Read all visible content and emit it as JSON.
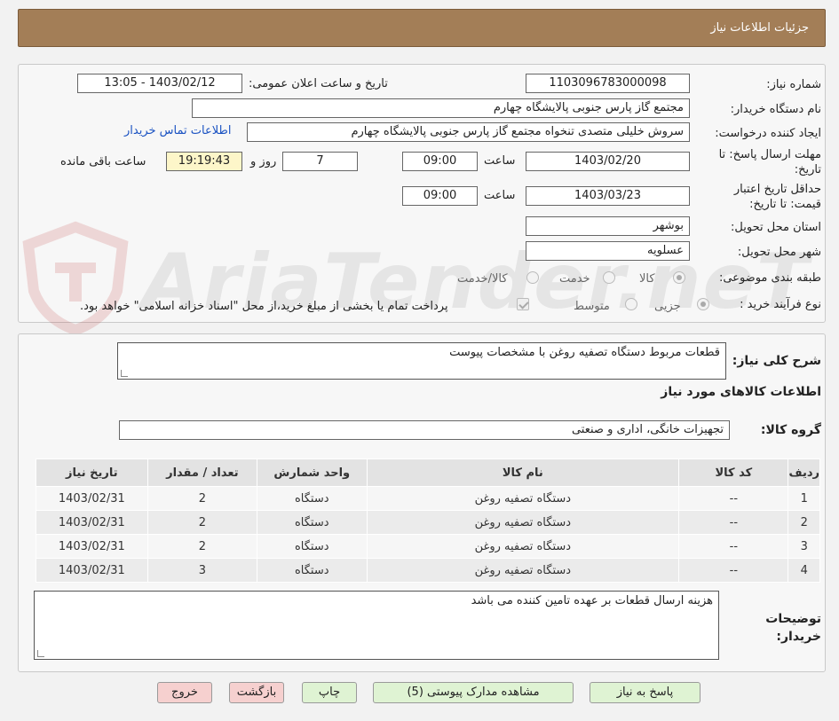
{
  "header": {
    "title": "جزئیات اطلاعات نیاز"
  },
  "form": {
    "need_number_label": "شماره نیاز:",
    "need_number": "1103096783000098",
    "announce_label": "تاریخ و ساعت اعلان عمومی:",
    "announce_value": "1403/02/12 - 13:05",
    "buyer_org_label": "نام دستگاه خریدار:",
    "buyer_org": "مجتمع گاز پارس جنوبی  پالایشگاه چهارم",
    "requester_label": "ایجاد کننده درخواست:",
    "requester": "سروش خلیلی متصدی تنخواه مجتمع گاز پارس جنوبی  پالایشگاه چهارم",
    "contact_link": "اطلاعات تماس خریدار",
    "deadline_label": "مهلت ارسال پاسخ: تا تاریخ:",
    "deadline_date": "1403/02/20",
    "time_label": "ساعت",
    "deadline_time": "09:00",
    "days_value": "7",
    "days_label": "روز و",
    "remaining_time": "19:19:43",
    "remaining_label": "ساعت باقی مانده",
    "validity_label": "حداقل تاریخ اعتبار قیمت: تا تاریخ:",
    "validity_date": "1403/03/23",
    "validity_time": "09:00",
    "province_label": "استان محل تحویل:",
    "province": "بوشهر",
    "city_label": "شهر محل تحویل:",
    "city": "عسلویه",
    "category_label": "طبقه بندی موضوعی:",
    "category_options": [
      "کالا",
      "خدمت",
      "کالا/خدمت"
    ],
    "process_label": "نوع فرآیند خرید :",
    "process_options": [
      "جزیی",
      "متوسط"
    ],
    "payment_note": "پرداخت تمام یا بخشی از مبلغ خرید،از محل \"اسناد خزانه اسلامی\" خواهد بود."
  },
  "watermark": "AriaTender.neT",
  "details": {
    "description_label": "شرح کلی نیاز:",
    "description": "قطعات مربوط دستگاه تصفیه روغن با مشخصات پیوست",
    "goods_info_title": "اطلاعات کالاهای مورد نیاز",
    "group_label": "گروه کالا:",
    "group_value": "تجهیزات خانگی، اداری و صنعتی",
    "table_headers": [
      "ردیف",
      "کد کالا",
      "نام کالا",
      "واحد شمارش",
      "تعداد / مقدار",
      "تاریخ نیاز"
    ],
    "rows": [
      [
        "1",
        "--",
        "دستگاه تصفیه روغن",
        "دستگاه",
        "2",
        "1403/02/31"
      ],
      [
        "2",
        "--",
        "دستگاه تصفیه روغن",
        "دستگاه",
        "2",
        "1403/02/31"
      ],
      [
        "3",
        "--",
        "دستگاه تصفیه روغن",
        "دستگاه",
        "2",
        "1403/02/31"
      ],
      [
        "4",
        "--",
        "دستگاه تصفیه روغن",
        "دستگاه",
        "3",
        "1403/02/31"
      ]
    ],
    "buyer_notes_label": "توضیحات خریدار:",
    "buyer_notes": "هزینه ارسال قطعات بر عهده تامین کننده می باشد"
  },
  "buttons": {
    "reply": "پاسخ به نیاز",
    "attachments": "مشاهده مدارک پیوستی (5)",
    "print": "چاپ",
    "back": "بازگشت",
    "exit": "خروج"
  }
}
